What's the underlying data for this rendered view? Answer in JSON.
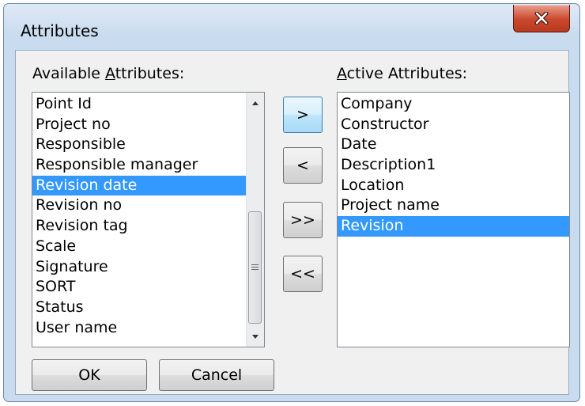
{
  "window": {
    "title": "Attributes",
    "close_icon": "close-icon"
  },
  "available": {
    "label_prefix": "Available ",
    "label_accel": "A",
    "label_rest": "ttributes:",
    "items": [
      "Point Id",
      "Project no",
      "Responsible",
      "Responsible manager",
      "Revision date",
      "Revision no",
      "Revision tag",
      "Scale",
      "Signature",
      "SORT",
      "Status",
      "User name"
    ],
    "selected": "Revision date"
  },
  "active": {
    "label_accel": "A",
    "label_rest": "ctive Attributes:",
    "items": [
      "Company",
      "Constructor",
      "Date",
      "Description1",
      "Location",
      "Project name",
      "Revision"
    ],
    "selected": "Revision"
  },
  "transfer_buttons": {
    "add": ">",
    "remove": "<",
    "add_all": ">>",
    "remove_all": "<<"
  },
  "buttons": {
    "ok": "OK",
    "cancel": "Cancel"
  },
  "colors": {
    "selection": "#3399ff",
    "close_button": "#c9482e",
    "frame": "#c9dbef"
  }
}
